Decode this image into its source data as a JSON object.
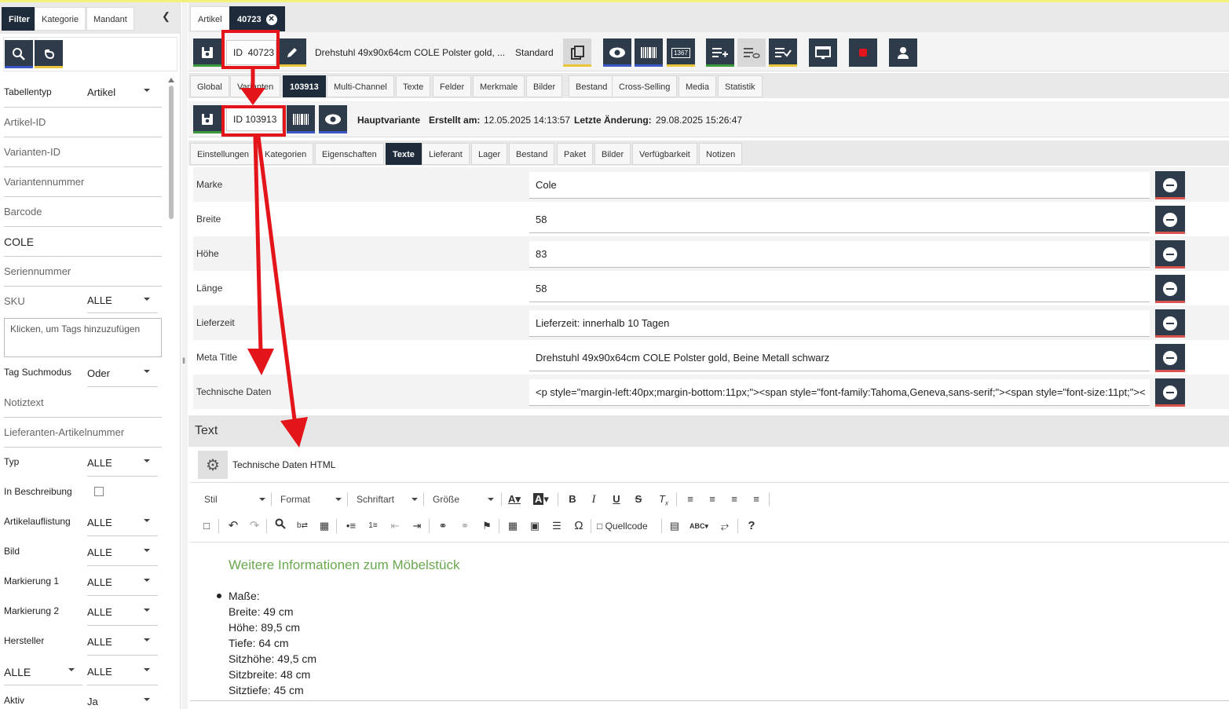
{
  "sidebar": {
    "tabs": [
      "Filter",
      "Kategorie",
      "Mandant"
    ],
    "collapse_icon": "chevron-left-icon",
    "tools": {
      "search_icon": "search-icon",
      "reset_icon": "undo-icon"
    },
    "fields": {
      "tabellentyp": {
        "label": "Tabellentyp",
        "value": "Artikel"
      },
      "artikel_id": "Artikel-ID",
      "varianten_id": "Varianten-ID",
      "variantennummer": "Variantennummer",
      "barcode": "Barcode",
      "search_text": "COLE",
      "seriennummer": "Seriennummer",
      "sku": {
        "label": "SKU",
        "value": "ALLE"
      },
      "tags_placeholder": "Klicken, um Tags hinzuzufügen",
      "tag_suchmodus": {
        "label": "Tag Suchmodus",
        "value": "Oder"
      },
      "notiztext": "Notiztext",
      "lieferanten_artikelnummer": "Lieferanten-Artikelnummer",
      "typ": {
        "label": "Typ",
        "value": "ALLE"
      },
      "in_beschreibung": {
        "label": "In Beschreibung"
      },
      "artikelauflistung": {
        "label": "Artikelauflistung",
        "value": "ALLE"
      },
      "bild": {
        "label": "Bild",
        "value": "ALLE"
      },
      "markierung1": {
        "label": "Markierung 1",
        "value": "ALLE"
      },
      "markierung2": {
        "label": "Markierung 2",
        "value": "ALLE"
      },
      "hersteller": {
        "label": "Hersteller",
        "value": "ALLE"
      },
      "alle_select": {
        "left": "ALLE",
        "right": "ALLE"
      },
      "aktiv": {
        "label": "Aktiv",
        "value": "Ja"
      }
    }
  },
  "doc_tabs": {
    "artikel": "Artikel",
    "current": "40723"
  },
  "article_toolbar": {
    "id_label": "ID",
    "id_value": "40723",
    "title": "Drehstuhl 49x90x64cm COLE Polster gold, ...",
    "standard": "Standard",
    "icons": [
      "save-icon",
      "edit-icon",
      "copy-icon",
      "eye-icon",
      "barcode-icon",
      "number-badge-icon",
      "list-add-icon",
      "list-view-icon",
      "list-check-icon",
      "screen-icon",
      "record-icon",
      "user-icon"
    ],
    "badge_text": "1367",
    "accent_colors": {
      "green": "#3c9a3c",
      "yellow": "#e8c53a",
      "blue": "#3a57c4",
      "red": "#d9534f"
    }
  },
  "article_tabs": [
    "Global",
    "Varianten",
    "103913",
    "Multi-Channel",
    "Texte",
    "Felder",
    "Merkmale",
    "Bilder",
    "Bestand",
    "Cross-Selling",
    "Media",
    "Statistik"
  ],
  "variant_toolbar": {
    "id_label": "ID",
    "id_value": "103913",
    "hauptvariante": "Hauptvariante",
    "erstellt_label": "Erstellt am:",
    "erstellt_value": "12.05.2025 14:13:57",
    "aenderung_label": "Letzte Änderung:",
    "aenderung_value": "29.08.2025 15:26:47"
  },
  "variant_tabs": [
    "Einstellungen",
    "Kategorien",
    "Eigenschaften",
    "Texte",
    "Lieferant",
    "Lager",
    "Bestand",
    "Paket",
    "Bilder",
    "Verfügbarkeit",
    "Notizen"
  ],
  "text_fields": [
    {
      "label": "Marke",
      "value": "Cole"
    },
    {
      "label": "Breite",
      "value": "58"
    },
    {
      "label": "Höhe",
      "value": "83"
    },
    {
      "label": "Länge",
      "value": "58"
    },
    {
      "label": "Lieferzeit",
      "value": "Lieferzeit: innerhalb 10 Tagen"
    },
    {
      "label": "Meta Title",
      "value": "Drehstuhl 49x90x64cm COLE Polster gold, Beine Metall schwarz"
    },
    {
      "label": "Technische Daten",
      "value": "<p style=\"margin-left:40px;margin-bottom:11px;\"><span style=\"font-family:Tahoma,Geneva,sans-serif;\"><span style=\"font-size:11pt;\"><"
    }
  ],
  "text_section": {
    "heading": "Text",
    "editor_title": "Technische Daten HTML",
    "combos": [
      "Stil",
      "Format",
      "Schriftart",
      "Größe"
    ],
    "quellcode": "Quellcode"
  },
  "editor_content": {
    "heading": "Weitere Informationen zum Möbelstück",
    "list_lines": [
      "Maße:",
      "Breite: 49 cm",
      "Höhe: 89,5 cm",
      "Tiefe: 64 cm",
      "Sitzhöhe: 49,5 cm",
      "Sitzbreite: 48 cm",
      "Sitztiefe: 45 cm"
    ]
  }
}
